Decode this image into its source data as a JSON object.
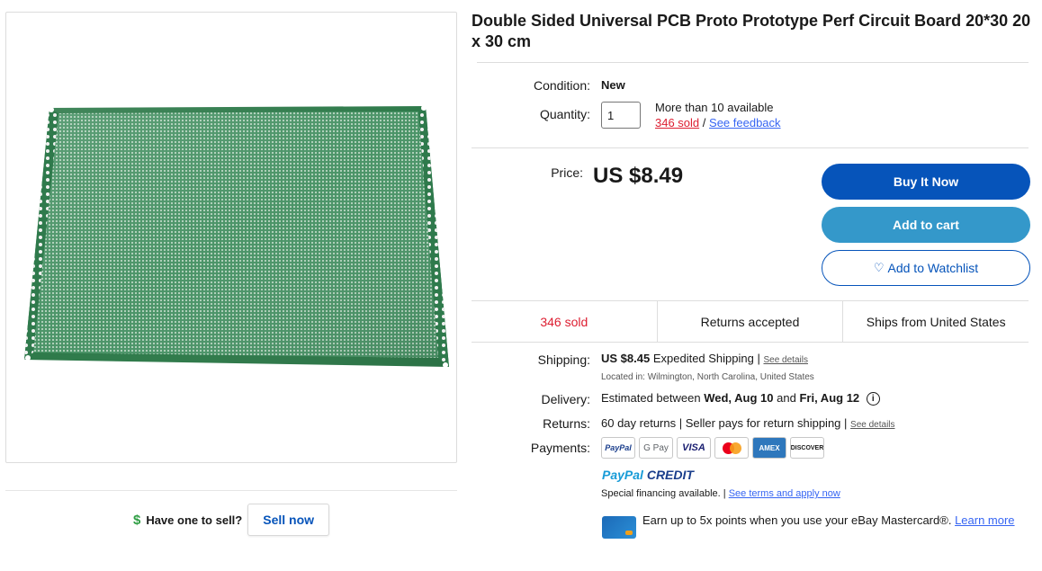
{
  "product": {
    "title": "Double Sided Universal PCB Proto Prototype Perf Circuit Board 20*30 20 x 30 cm"
  },
  "sell": {
    "question": "Have one to sell?",
    "button": "Sell now",
    "icon": "dollar-icon"
  },
  "condition": {
    "label": "Condition:",
    "value": "New"
  },
  "quantity": {
    "label": "Quantity:",
    "value": "1",
    "available": "More than 10 available",
    "sold_link": "346 sold",
    "separator": "/",
    "feedback_link": "See feedback"
  },
  "price": {
    "label": "Price:",
    "value": "US $8.49"
  },
  "actions": {
    "buy_now": "Buy It Now",
    "add_to_cart": "Add to cart",
    "watchlist": "Add to Watchlist"
  },
  "stats": {
    "sold": "346 sold",
    "returns": "Returns accepted",
    "ships_from": "Ships from United States"
  },
  "shipping": {
    "label": "Shipping:",
    "amount": "US $8.45",
    "method": "Expedited Shipping |",
    "details_link": "See details",
    "location": "Located in: Wilmington, North Carolina, United States"
  },
  "delivery": {
    "label": "Delivery:",
    "prefix": "Estimated between",
    "start": "Wed, Aug 10",
    "and": "and",
    "end": "Fri, Aug 12",
    "info_icon": "i"
  },
  "returns": {
    "label": "Returns:",
    "text": "60 day returns | Seller pays for return shipping |",
    "details_link": "See details"
  },
  "payments": {
    "label": "Payments:",
    "methods": [
      "PayPal",
      "G Pay",
      "VISA",
      "Mastercard",
      "AMEX",
      "DISCOVER"
    ]
  },
  "paypal_credit": {
    "brand_pay": "PayPal",
    "brand_credit": "CREDIT",
    "special": "Special financing available. |",
    "terms_link": "See terms and apply now"
  },
  "mastercard_promo": {
    "text": "Earn up to 5x points when you use your eBay Mastercard®.",
    "link": "Learn more"
  },
  "colors": {
    "buy_now": "#0654ba",
    "add_to_cart": "#3498ca",
    "sold_red": "#dd1e31",
    "link_blue": "#3665f3",
    "pcb_green": "#3d8f5e"
  }
}
